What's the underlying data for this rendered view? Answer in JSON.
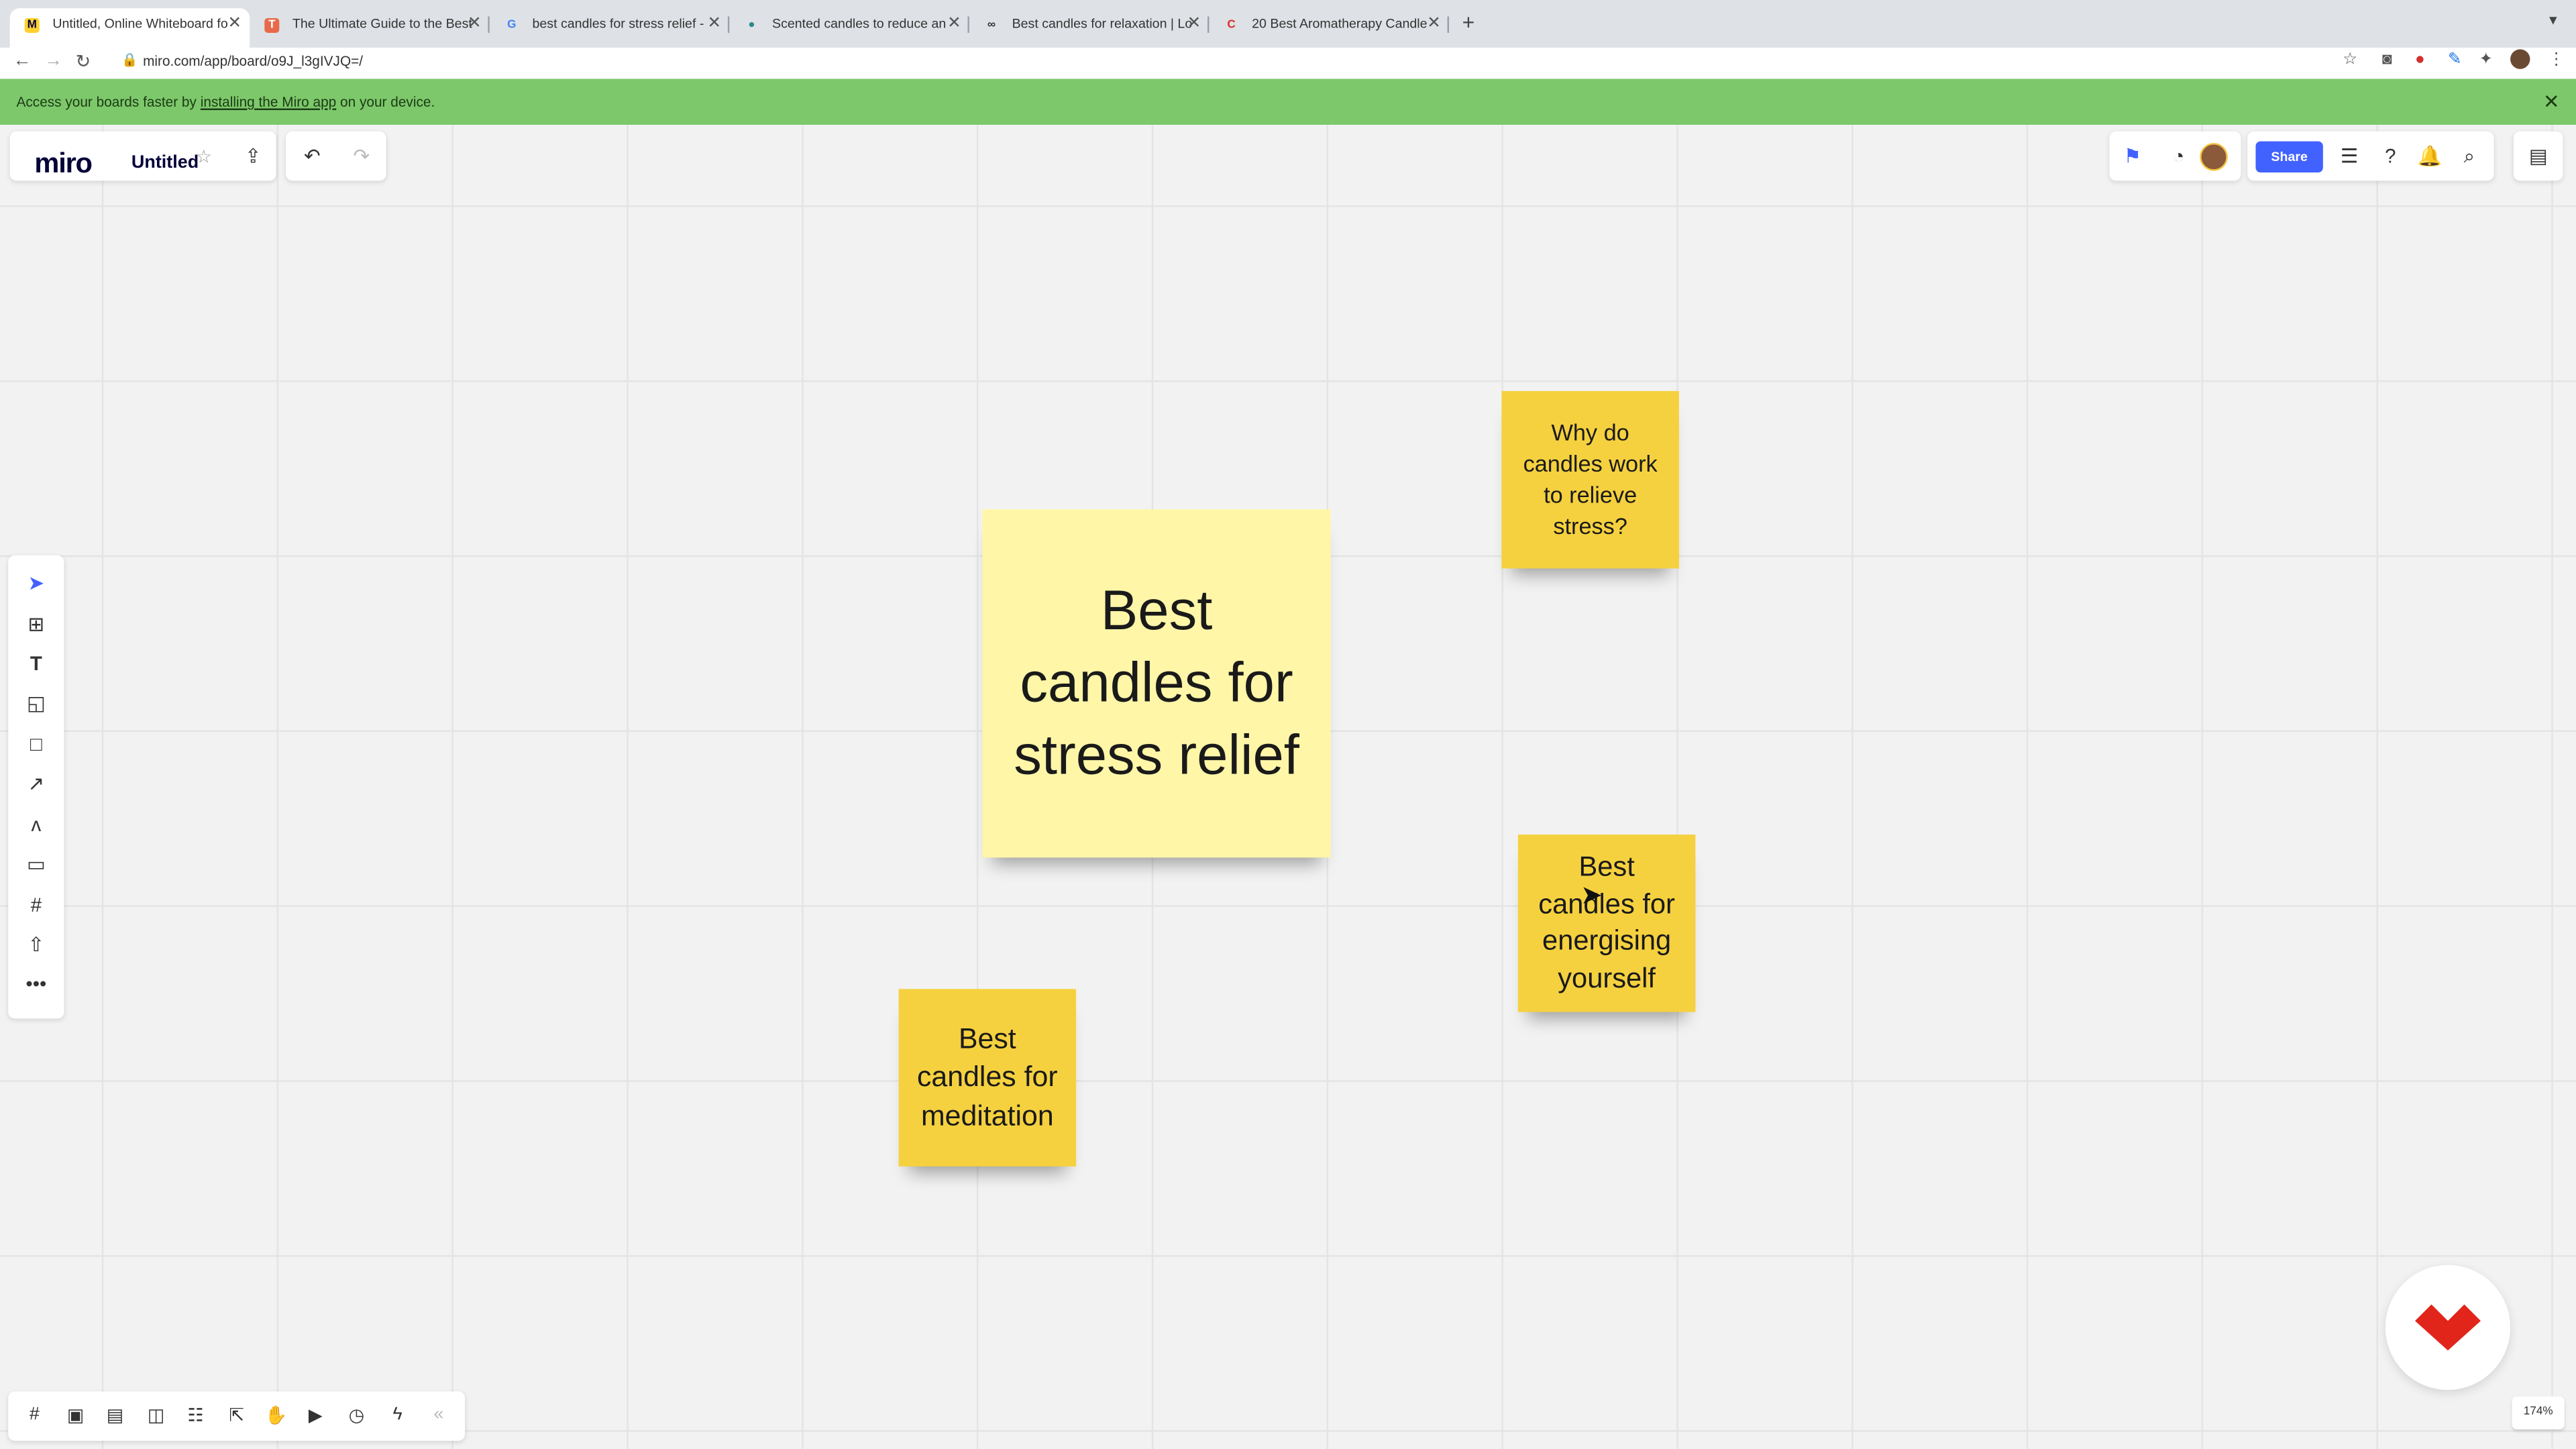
{
  "browser": {
    "tabs": [
      {
        "title": "Untitled, Online Whiteboard fo",
        "active": true
      },
      {
        "title": "The Ultimate Guide to the Best",
        "active": false
      },
      {
        "title": "best candles for stress relief -",
        "active": false
      },
      {
        "title": "Scented candles to reduce an",
        "active": false
      },
      {
        "title": "Best candles for relaxation | Lo",
        "active": false
      },
      {
        "title": "20 Best Aromatherapy Candle",
        "active": false
      }
    ],
    "url": "miro.com/app/board/o9J_l3gIVJQ=/"
  },
  "banner": {
    "prefix": "Access your boards faster by",
    "link": "installing the Miro app",
    "suffix": "on your device."
  },
  "board": {
    "logo": "miro",
    "name": "Untitled"
  },
  "toolbar": {
    "share_label": "Share"
  },
  "stickies": [
    {
      "text": "Best candles for stress relief",
      "color": "#fff6a8"
    },
    {
      "text": "Why do candles work to relieve stress?",
      "color": "#f5d13f"
    },
    {
      "text": "Best candles for energising yourself",
      "color": "#f5d13f"
    },
    {
      "text": "Best candles for meditation",
      "color": "#f5d13f"
    }
  ],
  "zoom": "174%",
  "colors": {
    "banner": "#7dc86b",
    "share": "#4262ff",
    "logo_mark": "#e1251b"
  }
}
